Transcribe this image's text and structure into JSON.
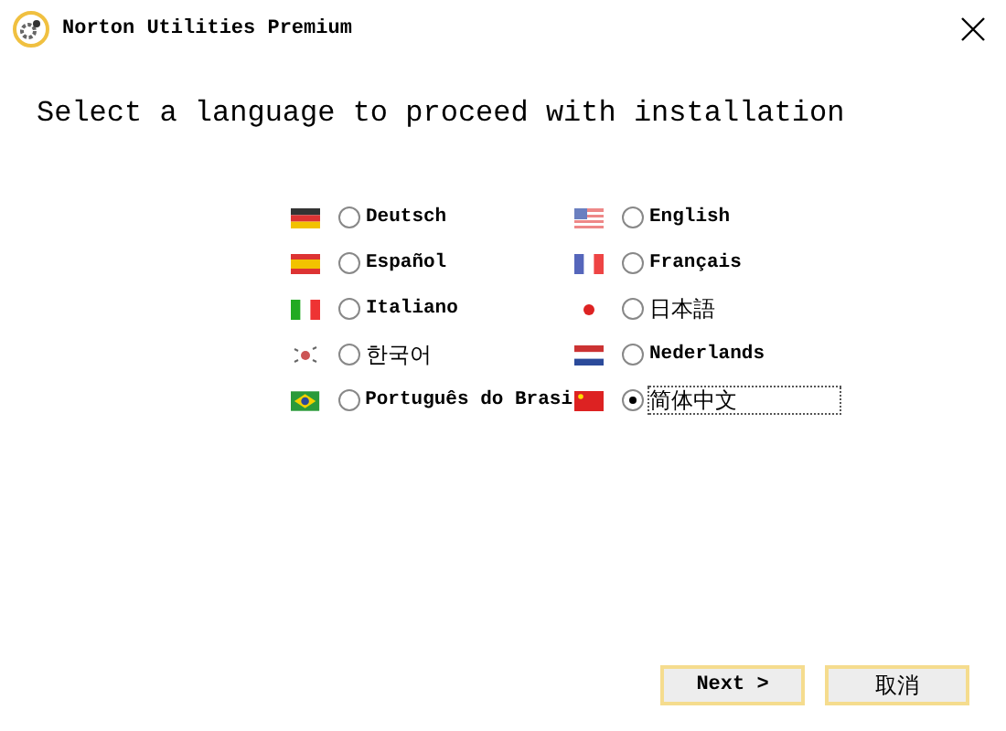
{
  "window": {
    "title": "Norton Utilities Premium"
  },
  "heading": "Select a language to proceed with installation",
  "languages": [
    {
      "label": "Deutsch",
      "selected": false
    },
    {
      "label": "English",
      "selected": false
    },
    {
      "label": "Español",
      "selected": false
    },
    {
      "label": "Français",
      "selected": false
    },
    {
      "label": "Italiano",
      "selected": false
    },
    {
      "label": "日本語",
      "selected": false
    },
    {
      "label": "한국어",
      "selected": false
    },
    {
      "label": "Nederlands",
      "selected": false
    },
    {
      "label": "Português do Brasi",
      "selected": false
    },
    {
      "label": "简体中文",
      "selected": true
    }
  ],
  "buttons": [
    {
      "label": "Next >"
    },
    {
      "label": "取消"
    }
  ]
}
